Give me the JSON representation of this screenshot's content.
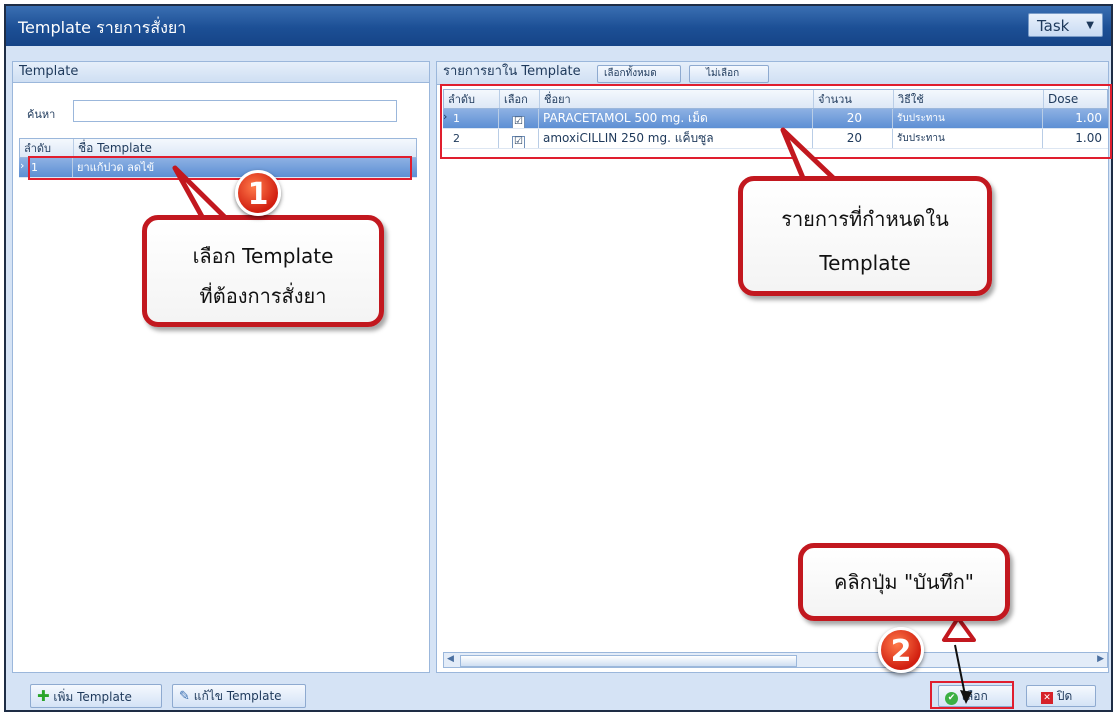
{
  "window": {
    "title": "Template รายการสั่งยา",
    "task_label": "Task"
  },
  "left_panel": {
    "header": "Template",
    "search_label": "ค้นหา",
    "search_value": "",
    "columns": [
      "ลำดับ",
      "ชื่อ Template"
    ],
    "rows": [
      {
        "no": "1",
        "name": "ยาแก้ปวด ลดไข้"
      }
    ]
  },
  "right_panel": {
    "header": "รายการยาใน Template",
    "select_all_label": "เลือกทั้งหมด",
    "deselect_label": "ไม่เลือก",
    "columns": [
      "ลำดับ",
      "เลือก",
      "ชื่อยา",
      "จำนวน",
      "วิธีใช้",
      "Dose"
    ],
    "rows": [
      {
        "no": "1",
        "checked": "☑",
        "drug": "PARACETAMOL 500 mg. เม็ด",
        "qty": "20",
        "usage": "รับประทาน",
        "dose": "1.00"
      },
      {
        "no": "2",
        "checked": "☑",
        "drug": "amoxiCILLIN 250 mg. แค็บซูล",
        "qty": "20",
        "usage": "รับประทาน",
        "dose": "1.00"
      }
    ]
  },
  "footer": {
    "add_template_label": "เพิ่ม Template",
    "edit_template_label": "แก้ไข Template",
    "select_label": "เลือก",
    "close_label": "ปิด"
  },
  "annotations": {
    "callout1_line1": "เลือก Template",
    "callout1_line2": "ที่ต้องการสั่งยา",
    "callout2_line1": "รายการที่กำหนดใน",
    "callout2_line2": "Template",
    "callout3": "คลิกปุ่ม \"บันทึก\"",
    "badge1": "1",
    "badge2": "2"
  },
  "colors": {
    "accent_red": "#c2181f",
    "title_blue": "#1c4f95",
    "selection_blue": "#5d8fd4"
  }
}
